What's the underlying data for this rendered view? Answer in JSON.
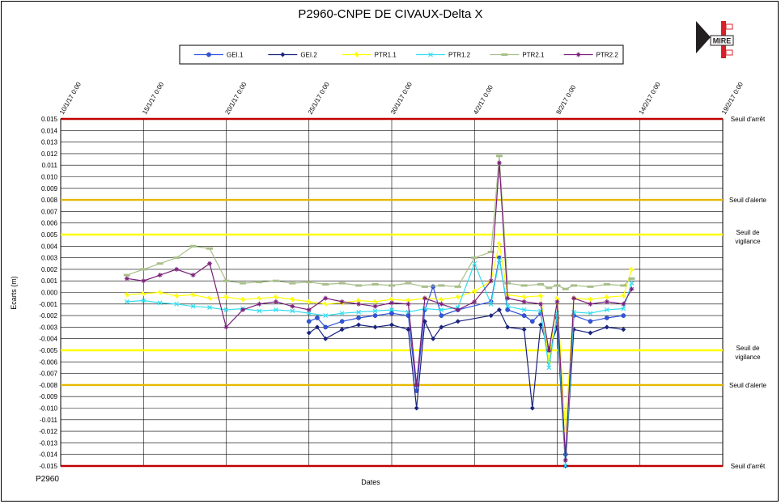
{
  "title": "P2960-CNPE DE CIVAUX-Delta X",
  "corner_label": "P2960",
  "logo": {
    "icon": "mire-logo-icon",
    "text": "MIRE",
    "colors": {
      "red": "#d8202a",
      "dark": "#231f20"
    }
  },
  "chart_data": {
    "type": "line",
    "title": "P2960-CNPE DE CIVAUX-Delta X",
    "xlabel": "Dates",
    "ylabel": "Ecarts (m)",
    "xlim": [
      "2017-01-10",
      "2017-02-19"
    ],
    "ylim": [
      -0.015,
      0.015
    ],
    "x_ticks": [
      "10/1/17 0:00",
      "15/1/17 0:00",
      "20/1/17 0:00",
      "25/1/17 0:00",
      "30/1/17 0:00",
      "4/2/17 0:00",
      "9/2/17 0:00",
      "14/2/17 0:00",
      "19/2/17 0:00"
    ],
    "y_ticks": [
      "0.015",
      "0.014",
      "0.013",
      "0.012",
      "0.011",
      "0.010",
      "0.009",
      "0.008",
      "0.007",
      "0.006",
      "0.005",
      "0.004",
      "0.003",
      "0.002",
      "0.001",
      "0.000",
      "-0.001",
      "-0.002",
      "-0.003",
      "-0.004",
      "-0.005",
      "-0.006",
      "-0.007",
      "-0.008",
      "-0.009",
      "-0.010",
      "-0.011",
      "-0.012",
      "-0.013",
      "-0.014",
      "-0.015"
    ],
    "grid": true,
    "legend_position": "top",
    "thresholds": [
      {
        "value": 0.015,
        "label": "Seuil d'arrêt",
        "color": "#c00000"
      },
      {
        "value": 0.008,
        "label": "Seuil d'alerte",
        "color": "#e6b800"
      },
      {
        "value": 0.005,
        "label": "Seuil de vigilance",
        "label_lines": [
          "Seuil de",
          "vigilance"
        ],
        "color": "#ffff00"
      },
      {
        "value": -0.005,
        "label": "Seuil de vigilance",
        "label_lines": [
          "Seuil de",
          "vigilance"
        ],
        "color": "#ffff00"
      },
      {
        "value": -0.008,
        "label": "Seuil d'alerte",
        "color": "#e6b800"
      },
      {
        "value": -0.015,
        "label": "Seuil d'arrêt",
        "color": "#c00000"
      }
    ],
    "series": [
      {
        "name": "GEI.1",
        "color": "#3355dd",
        "marker": "circle",
        "x": [
          "2017-01-25",
          "2017-01-25T12:00",
          "2017-01-26",
          "2017-01-27",
          "2017-01-28",
          "2017-01-29",
          "2017-01-30",
          "2017-01-31",
          "2017-01-31T12:00",
          "2017-02-01",
          "2017-02-01T12:00",
          "2017-02-02",
          "2017-02-03",
          "2017-02-05",
          "2017-02-05T12:00",
          "2017-02-06",
          "2017-02-07",
          "2017-02-07T12:00",
          "2017-02-08",
          "2017-02-08T12:00",
          "2017-02-09",
          "2017-02-09T12:00",
          "2017-02-10",
          "2017-02-11",
          "2017-02-12",
          "2017-02-13"
        ],
        "y": [
          -0.0025,
          -0.0022,
          -0.003,
          -0.0025,
          -0.0022,
          -0.002,
          -0.0018,
          -0.002,
          -0.0085,
          -0.0015,
          0.0005,
          -0.002,
          -0.0015,
          -0.0008,
          0.003,
          -0.0015,
          -0.002,
          -0.0025,
          -0.0018,
          -0.006,
          -0.0022,
          -0.014,
          -0.002,
          -0.0025,
          -0.0022,
          -0.002
        ]
      },
      {
        "name": "GEI.2",
        "color": "#1a237e",
        "marker": "diamond",
        "x": [
          "2017-01-25",
          "2017-01-25T12:00",
          "2017-01-26",
          "2017-01-27",
          "2017-01-28",
          "2017-01-29",
          "2017-01-30",
          "2017-01-31",
          "2017-01-31T12:00",
          "2017-02-01",
          "2017-02-01T12:00",
          "2017-02-02",
          "2017-02-03",
          "2017-02-05",
          "2017-02-05T12:00",
          "2017-02-06",
          "2017-02-07",
          "2017-02-07T12:00",
          "2017-02-08",
          "2017-02-08T12:00",
          "2017-02-09",
          "2017-02-09T12:00",
          "2017-02-10",
          "2017-02-11",
          "2017-02-12",
          "2017-02-13"
        ],
        "y": [
          -0.0035,
          -0.003,
          -0.004,
          -0.0032,
          -0.0028,
          -0.003,
          -0.0028,
          -0.0032,
          -0.01,
          -0.0025,
          -0.004,
          -0.003,
          -0.0025,
          -0.002,
          -0.0015,
          -0.003,
          -0.0032,
          -0.01,
          -0.0028,
          -0.005,
          -0.003,
          -0.015,
          -0.0032,
          -0.0035,
          -0.003,
          -0.0032
        ]
      },
      {
        "name": "PTR1.1",
        "color": "#ffff00",
        "marker": "star",
        "x": [
          "2017-01-14",
          "2017-01-15",
          "2017-01-16",
          "2017-01-17",
          "2017-01-18",
          "2017-01-19",
          "2017-01-20",
          "2017-01-21",
          "2017-01-22",
          "2017-01-23",
          "2017-01-24",
          "2017-01-25",
          "2017-01-26",
          "2017-01-27",
          "2017-01-28",
          "2017-01-29",
          "2017-01-30",
          "2017-01-31",
          "2017-02-01",
          "2017-02-02",
          "2017-02-03",
          "2017-02-04",
          "2017-02-05",
          "2017-02-05T12:00",
          "2017-02-06",
          "2017-02-07",
          "2017-02-08",
          "2017-02-08T12:00",
          "2017-02-09",
          "2017-02-09T12:00",
          "2017-02-10",
          "2017-02-11",
          "2017-02-12",
          "2017-02-13",
          "2017-02-13T12:00"
        ],
        "y": [
          -0.0002,
          -0.0001,
          0.0,
          -0.0003,
          -0.0002,
          -0.0005,
          -0.0004,
          -0.0006,
          -0.0005,
          -0.0004,
          -0.0006,
          -0.0008,
          -0.001,
          -0.0009,
          -0.0007,
          -0.0008,
          -0.0006,
          -0.0007,
          -0.0005,
          -0.0006,
          -0.0004,
          0.0001,
          0.001,
          0.0042,
          -0.0002,
          -0.0004,
          -0.0003,
          -0.006,
          -0.0005,
          -0.012,
          -0.0005,
          -0.0006,
          -0.0004,
          -0.0003,
          0.002
        ]
      },
      {
        "name": "PTR1.2",
        "color": "#33ddee",
        "marker": "cross",
        "x": [
          "2017-01-14",
          "2017-01-15",
          "2017-01-16",
          "2017-01-17",
          "2017-01-18",
          "2017-01-19",
          "2017-01-20",
          "2017-01-21",
          "2017-01-22",
          "2017-01-23",
          "2017-01-24",
          "2017-01-25",
          "2017-01-26",
          "2017-01-27",
          "2017-01-28",
          "2017-01-29",
          "2017-01-30",
          "2017-01-31",
          "2017-02-01",
          "2017-02-02",
          "2017-02-03",
          "2017-02-04",
          "2017-02-05",
          "2017-02-05T12:00",
          "2017-02-06",
          "2017-02-07",
          "2017-02-08",
          "2017-02-08T12:00",
          "2017-02-09",
          "2017-02-09T12:00",
          "2017-02-10",
          "2017-02-11",
          "2017-02-12",
          "2017-02-13",
          "2017-02-13T12:00"
        ],
        "y": [
          -0.0008,
          -0.0007,
          -0.0009,
          -0.001,
          -0.0012,
          -0.0013,
          -0.0015,
          -0.0014,
          -0.0016,
          -0.0015,
          -0.0016,
          -0.0018,
          -0.002,
          -0.0018,
          -0.0017,
          -0.0016,
          -0.0015,
          -0.0017,
          -0.0014,
          -0.0015,
          -0.0013,
          0.0025,
          -0.001,
          0.0028,
          -0.0012,
          -0.0015,
          -0.0016,
          -0.0065,
          -0.0018,
          -0.015,
          -0.0017,
          -0.0018,
          -0.0015,
          -0.0014,
          0.0008
        ]
      },
      {
        "name": "PTR2.1",
        "color": "#a8bf8a",
        "marker": "dash",
        "x": [
          "2017-01-14",
          "2017-01-15",
          "2017-01-16",
          "2017-01-17",
          "2017-01-18",
          "2017-01-19",
          "2017-01-20",
          "2017-01-21",
          "2017-01-22",
          "2017-01-23",
          "2017-01-24",
          "2017-01-25",
          "2017-01-26",
          "2017-01-27",
          "2017-01-28",
          "2017-01-29",
          "2017-01-30",
          "2017-01-31",
          "2017-02-01",
          "2017-02-02",
          "2017-02-03",
          "2017-02-04",
          "2017-02-05",
          "2017-02-05T12:00",
          "2017-02-06",
          "2017-02-07",
          "2017-02-08",
          "2017-02-08T12:00",
          "2017-02-09",
          "2017-02-09T12:00",
          "2017-02-10",
          "2017-02-11",
          "2017-02-12",
          "2017-02-13",
          "2017-02-13T12:00"
        ],
        "y": [
          0.0015,
          0.002,
          0.0025,
          0.003,
          0.004,
          0.0038,
          0.001,
          0.0008,
          0.0009,
          0.001,
          0.0008,
          0.0009,
          0.0007,
          0.0008,
          0.0006,
          0.0007,
          0.0006,
          0.0008,
          0.0005,
          0.0006,
          0.0005,
          0.003,
          0.0035,
          0.0118,
          0.0008,
          0.0006,
          0.0007,
          0.0004,
          0.0006,
          0.0003,
          0.0006,
          0.0005,
          0.0007,
          0.0006,
          0.0012
        ]
      },
      {
        "name": "PTR2.2",
        "color": "#7a1f7a",
        "marker": "asterisk",
        "x": [
          "2017-01-14",
          "2017-01-15",
          "2017-01-16",
          "2017-01-17",
          "2017-01-18",
          "2017-01-19",
          "2017-01-20",
          "2017-01-21",
          "2017-01-22",
          "2017-01-23",
          "2017-01-24",
          "2017-01-25",
          "2017-01-26",
          "2017-01-27",
          "2017-01-28",
          "2017-01-29",
          "2017-01-30",
          "2017-01-31",
          "2017-01-31T12:00",
          "2017-02-01",
          "2017-02-02",
          "2017-02-03",
          "2017-02-04",
          "2017-02-05",
          "2017-02-05T12:00",
          "2017-02-06",
          "2017-02-07",
          "2017-02-08",
          "2017-02-08T12:00",
          "2017-02-09",
          "2017-02-09T12:00",
          "2017-02-10",
          "2017-02-11",
          "2017-02-12",
          "2017-02-13",
          "2017-02-13T12:00"
        ],
        "y": [
          0.0012,
          0.001,
          0.0015,
          0.002,
          0.0015,
          0.0025,
          -0.003,
          -0.0015,
          -0.001,
          -0.0008,
          -0.0012,
          -0.0015,
          -0.0005,
          -0.0008,
          -0.001,
          -0.0012,
          -0.0009,
          -0.001,
          -0.008,
          -0.0005,
          -0.001,
          -0.0015,
          -0.0008,
          0.001,
          0.0112,
          -0.0005,
          -0.0008,
          -0.001,
          -0.005,
          -0.0008,
          -0.0145,
          -0.0005,
          -0.001,
          -0.0008,
          -0.001,
          0.0003
        ]
      }
    ]
  }
}
